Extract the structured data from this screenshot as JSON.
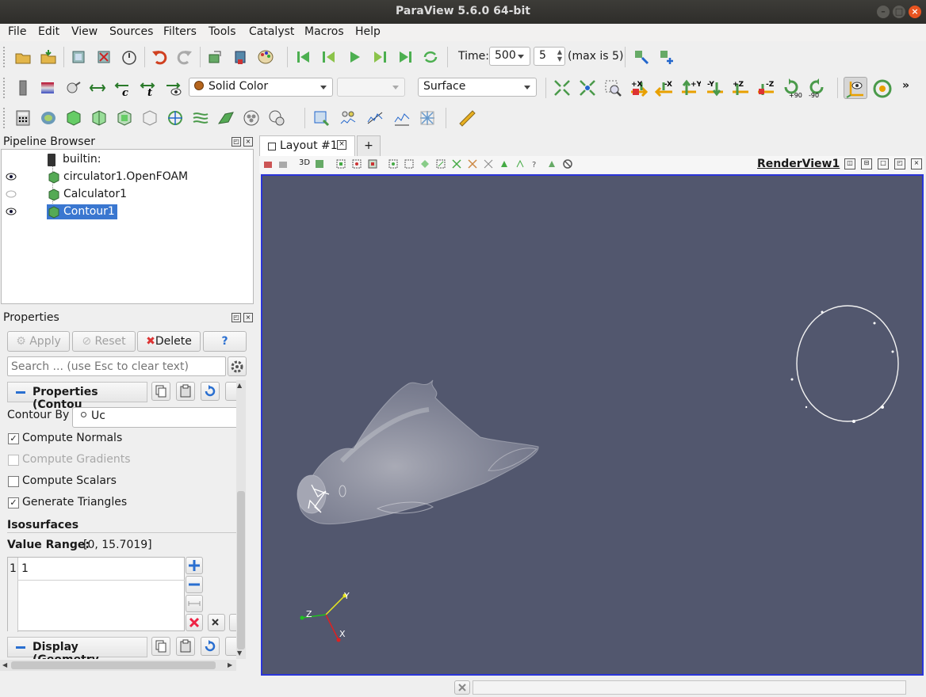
{
  "window": {
    "title": "ParaView 5.6.0 64-bit"
  },
  "menu": [
    "File",
    "Edit",
    "View",
    "Sources",
    "Filters",
    "Tools",
    "Catalyst",
    "Macros",
    "Help"
  ],
  "time_toolbar": {
    "time_label": "Time:",
    "time_value": "500",
    "index_value": "5",
    "max_label": "(max is 5)"
  },
  "display_toolbar": {
    "color_by": "Solid Color",
    "component": "",
    "representation": "Surface"
  },
  "camera_labels": [
    "+X",
    "-X",
    "+Y",
    "-Y",
    "+Z",
    "-Z",
    "+90",
    "-90"
  ],
  "overflow": "»",
  "pipeline": {
    "title": "Pipeline Browser",
    "items": [
      {
        "label": "builtin:",
        "visible": "none"
      },
      {
        "label": "circulator1.OpenFOAM",
        "visible": "on"
      },
      {
        "label": "Calculator1",
        "visible": "off"
      },
      {
        "label": "Contour1",
        "visible": "on",
        "selected": true
      }
    ]
  },
  "properties": {
    "title": "Properties",
    "apply": "Apply",
    "reset": "Reset",
    "delete": "Delete",
    "help": "?",
    "search_placeholder": "Search ... (use Esc to clear text)",
    "section_properties": "Properties (Contou",
    "contour_by_label": "Contour By",
    "contour_by_value": "Uc",
    "checks": [
      {
        "label": "Compute Normals",
        "checked": true,
        "enabled": true
      },
      {
        "label": "Compute Gradients",
        "checked": false,
        "enabled": false
      },
      {
        "label": "Compute Scalars",
        "checked": false,
        "enabled": true
      },
      {
        "label": "Generate Triangles",
        "checked": true,
        "enabled": true
      }
    ],
    "isosurfaces_label": "Isosurfaces",
    "value_range_label": "Value Range:",
    "value_range": "[0, 15.7019]",
    "iso_rows": [
      {
        "index": "1",
        "value": "1"
      }
    ],
    "section_display": "Display (Geometry"
  },
  "layout": {
    "tab_label": "Layout #1",
    "add_tab": "+",
    "threed_label": "3D",
    "view_name": "RenderView1"
  },
  "axes": {
    "x": "X",
    "y": "Y",
    "z": "Z"
  },
  "colors": {
    "viewport_bg": "#52576e",
    "viewport_border": "#2a34d8",
    "selection": "#3a77d0",
    "title_bar": "#2e2d2a",
    "ubuntu_orange": "#e95420"
  }
}
